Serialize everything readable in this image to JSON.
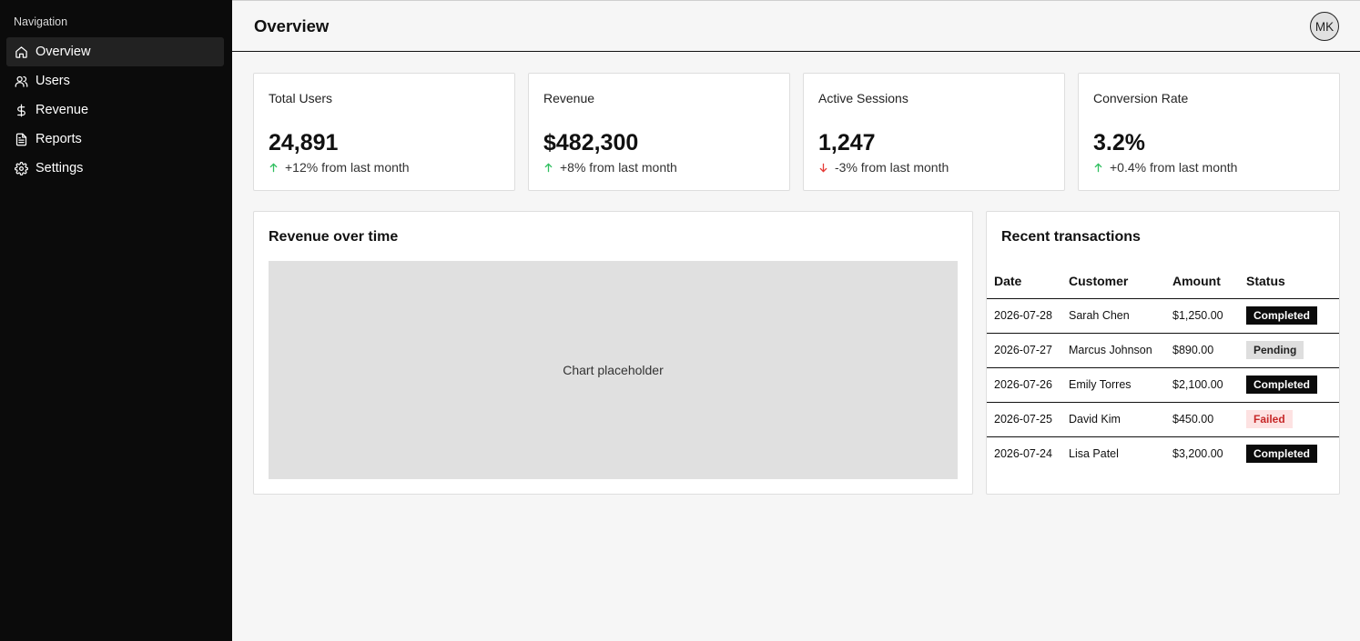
{
  "sidebar": {
    "heading": "Navigation",
    "items": [
      {
        "label": "Overview",
        "icon": "home-icon",
        "active": true
      },
      {
        "label": "Users",
        "icon": "users-icon",
        "active": false
      },
      {
        "label": "Revenue",
        "icon": "dollar-icon",
        "active": false
      },
      {
        "label": "Reports",
        "icon": "file-text-icon",
        "active": false
      },
      {
        "label": "Settings",
        "icon": "gear-icon",
        "active": false
      }
    ]
  },
  "header": {
    "title": "Overview",
    "avatar_initials": "MK"
  },
  "stats": [
    {
      "label": "Total Users",
      "value": "24,891",
      "change": "+12% from last month",
      "trend": "up"
    },
    {
      "label": "Revenue",
      "value": "$482,300",
      "change": "+8% from last month",
      "trend": "up"
    },
    {
      "label": "Active Sessions",
      "value": "1,247",
      "change": "-3% from last month",
      "trend": "down"
    },
    {
      "label": "Conversion Rate",
      "value": "3.2%",
      "change": "+0.4% from last month",
      "trend": "up"
    }
  ],
  "chart_panel": {
    "title": "Revenue over time",
    "placeholder": "Chart placeholder"
  },
  "transactions": {
    "title": "Recent transactions",
    "columns": [
      "Date",
      "Customer",
      "Amount",
      "Status"
    ],
    "rows": [
      {
        "date": "2026-07-28",
        "customer": "Sarah Chen",
        "amount": "$1,250.00",
        "status": "Completed"
      },
      {
        "date": "2026-07-27",
        "customer": "Marcus Johnson",
        "amount": "$890.00",
        "status": "Pending"
      },
      {
        "date": "2026-07-26",
        "customer": "Emily Torres",
        "amount": "$2,100.00",
        "status": "Completed"
      },
      {
        "date": "2026-07-25",
        "customer": "David Kim",
        "amount": "$450.00",
        "status": "Failed"
      },
      {
        "date": "2026-07-24",
        "customer": "Lisa Patel",
        "amount": "$3,200.00",
        "status": "Completed"
      }
    ]
  },
  "colors": {
    "sidebar_bg": "#0b0b0b",
    "trend_up": "#2fbf5f",
    "trend_down": "#e53935",
    "status_completed": "#0b0b0b",
    "status_pending": "#dedede",
    "status_failed": "#fde2e2"
  }
}
